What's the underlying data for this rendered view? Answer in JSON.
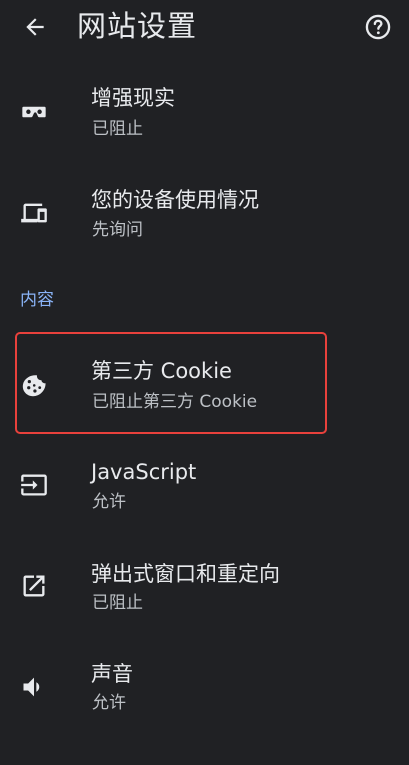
{
  "header": {
    "title": "网站设置",
    "back_icon": "arrow-back-icon",
    "help_icon": "help-circle-icon"
  },
  "rows_top": [
    {
      "label": "增强现实",
      "status": "已阻止",
      "icon": "vr-headset-icon"
    },
    {
      "label": "您的设备使用情况",
      "status": "先询问",
      "icon": "devices-icon"
    }
  ],
  "section": {
    "title": "内容"
  },
  "rows_content": [
    {
      "label": "第三方 Cookie",
      "status": "已阻止第三方 Cookie",
      "icon": "cookie-icon",
      "highlighted": true
    },
    {
      "label": "JavaScript",
      "status": "允许",
      "icon": "input-icon"
    },
    {
      "label": "弹出式窗口和重定向",
      "status": "已阻止",
      "icon": "open-in-new-icon"
    },
    {
      "label": "声音",
      "status": "允许",
      "icon": "volume-icon"
    }
  ],
  "colors": {
    "background": "#202124",
    "text_primary": "#e8eaed",
    "text_secondary": "#bdc1c6",
    "section_accent": "#8ab4f8",
    "highlight_border": "#e8413c"
  }
}
